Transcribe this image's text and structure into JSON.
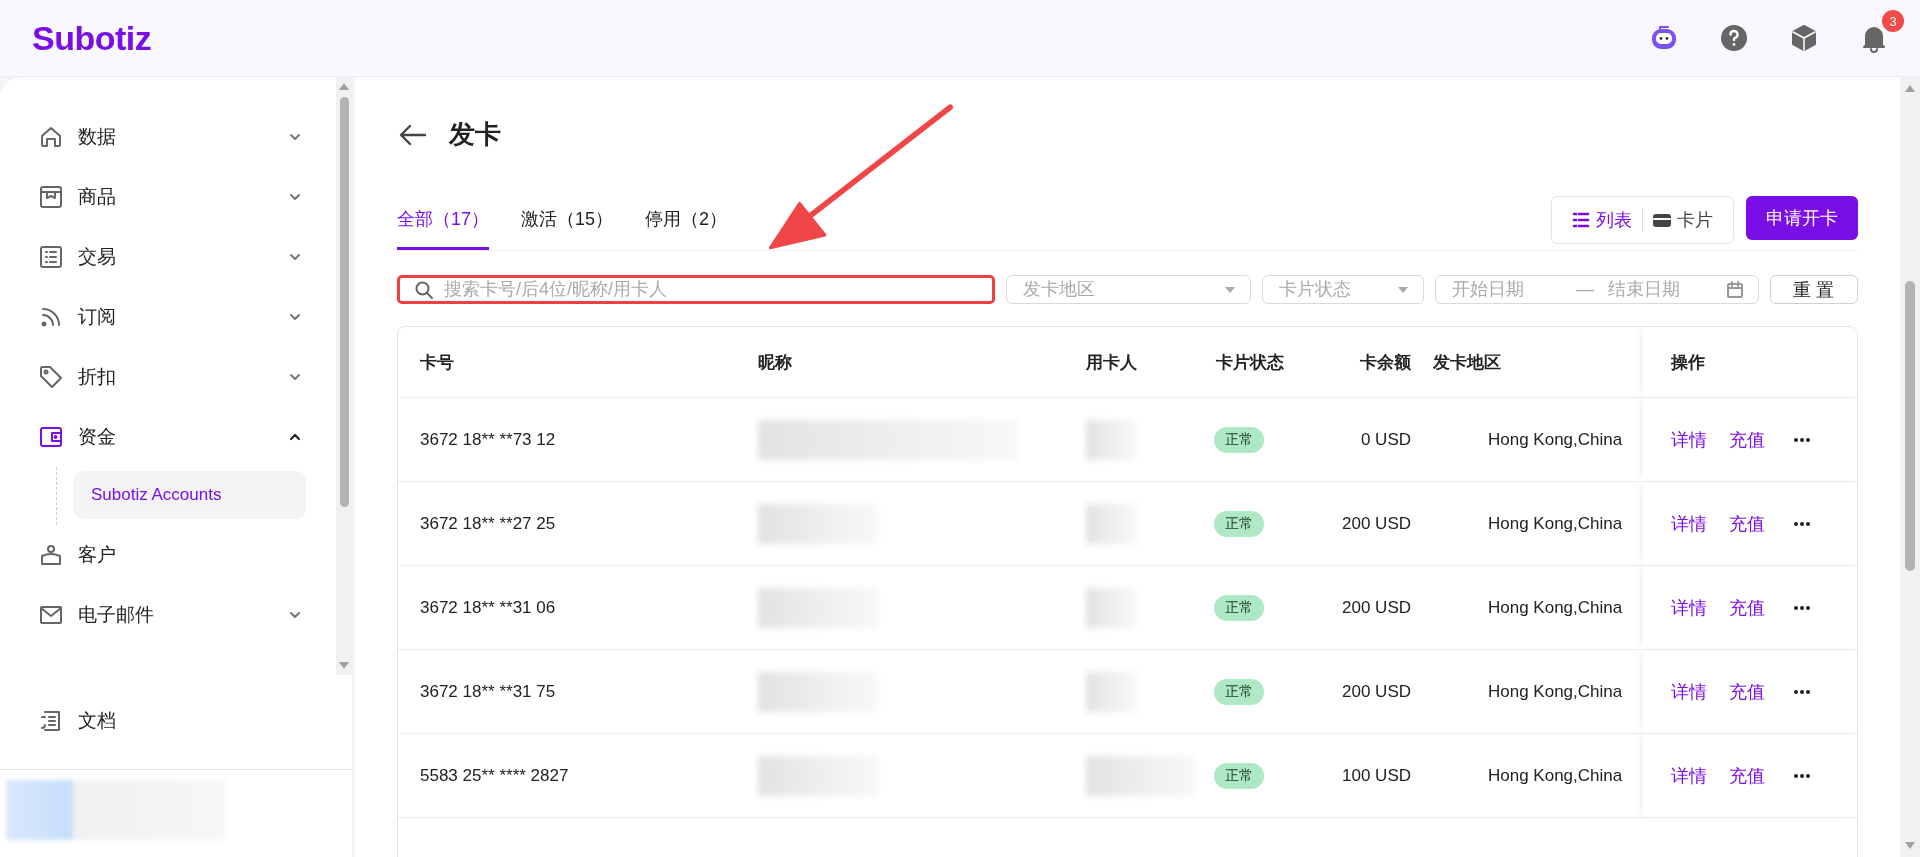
{
  "brand": {
    "logo": "Subotiz"
  },
  "header_icons": {
    "notifications_badge": "3"
  },
  "sidebar": {
    "items": [
      {
        "label": "数据",
        "kind": "group",
        "expanded": false,
        "selected": false
      },
      {
        "label": "商品",
        "kind": "group",
        "expanded": false,
        "selected": false
      },
      {
        "label": "交易",
        "kind": "group",
        "expanded": false,
        "selected": false
      },
      {
        "label": "订阅",
        "kind": "group",
        "expanded": false,
        "selected": false
      },
      {
        "label": "折扣",
        "kind": "group",
        "expanded": false,
        "selected": false
      },
      {
        "label": "资金",
        "kind": "group",
        "expanded": true,
        "selected": true,
        "children": [
          {
            "label": "Subotiz Accounts",
            "selected": true
          }
        ]
      },
      {
        "label": "客户",
        "kind": "link",
        "selected": false
      },
      {
        "label": "电子邮件",
        "kind": "group",
        "expanded": false,
        "selected": false
      }
    ],
    "footer_item": {
      "label": "文档"
    }
  },
  "page": {
    "title": "发卡"
  },
  "tabs": [
    {
      "label": "全部（17）",
      "selected": true
    },
    {
      "label": "激活（15）",
      "selected": false
    },
    {
      "label": "停用（2）",
      "selected": false
    }
  ],
  "view_toggle": [
    {
      "label": "列表",
      "selected": true
    },
    {
      "label": "卡片",
      "selected": false
    }
  ],
  "apply_button": "申请开卡",
  "filters": {
    "search": {
      "placeholder": "搜索卡号/后4位/昵称/用卡人",
      "highlighted": true
    },
    "region": {
      "placeholder": "发卡地区"
    },
    "status": {
      "placeholder": "卡片状态"
    },
    "date_start": {
      "placeholder": "开始日期"
    },
    "date_separator": "—",
    "date_end": {
      "placeholder": "结束日期"
    },
    "reset": "重 置"
  },
  "table": {
    "columns": [
      "卡号",
      "昵称",
      "用卡人",
      "卡片状态",
      "卡余额",
      "发卡地区",
      "操作"
    ],
    "rows": [
      {
        "card": "3672 18** **73 12",
        "status": "正常",
        "balance": "0 USD",
        "region": "Hong Kong,China",
        "actions": [
          "详情",
          "充值"
        ]
      },
      {
        "card": "3672 18** **27 25",
        "status": "正常",
        "balance": "200 USD",
        "region": "Hong Kong,China",
        "actions": [
          "详情",
          "充值"
        ]
      },
      {
        "card": "3672 18** **31 06",
        "status": "正常",
        "balance": "200 USD",
        "region": "Hong Kong,China",
        "actions": [
          "详情",
          "充值"
        ]
      },
      {
        "card": "3672 18** **31 75",
        "status": "正常",
        "balance": "200 USD",
        "region": "Hong Kong,China",
        "actions": [
          "详情",
          "充值"
        ]
      },
      {
        "card": "5583 25** **** 2827",
        "status": "正常",
        "balance": "100 USD",
        "region": "Hong Kong,China",
        "actions": [
          "详情",
          "充值"
        ]
      }
    ]
  }
}
